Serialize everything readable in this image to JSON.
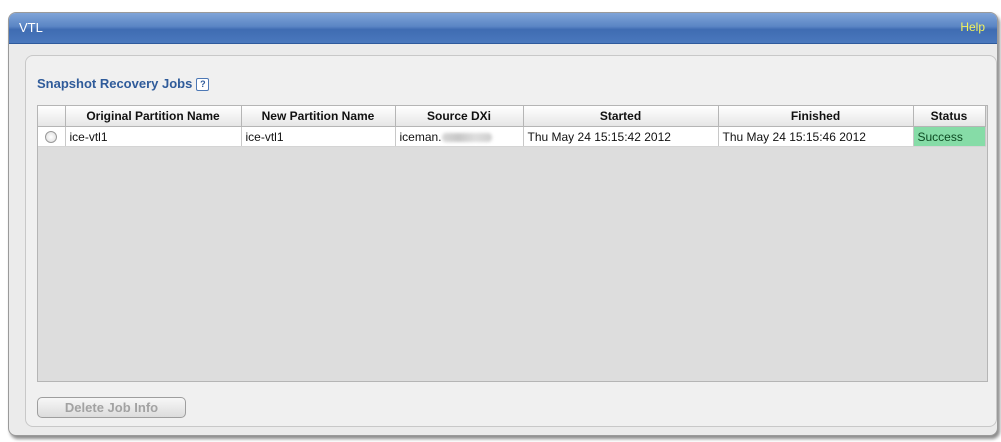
{
  "header": {
    "title": "VTL",
    "help_label": "Help"
  },
  "section": {
    "title": "Snapshot Recovery Jobs",
    "help_icon_glyph": "?"
  },
  "table": {
    "columns": [
      "Original Partition Name",
      "New Partition Name",
      "Source DXi",
      "Started",
      "Finished",
      "Status"
    ],
    "rows": [
      {
        "original": "ice-vtl1",
        "new": "ice-vtl1",
        "source": "iceman.",
        "started": "Thu May 24 15:15:42 2012",
        "finished": "Thu May 24 15:15:46 2012",
        "status": "Success"
      }
    ]
  },
  "actions": {
    "delete_label": "Delete Job Info"
  },
  "colors": {
    "header_blue": "#4a78bd",
    "help_yellow": "#f5f35a",
    "section_title_blue": "#2f5b9a",
    "success_green": "#86dca7"
  }
}
